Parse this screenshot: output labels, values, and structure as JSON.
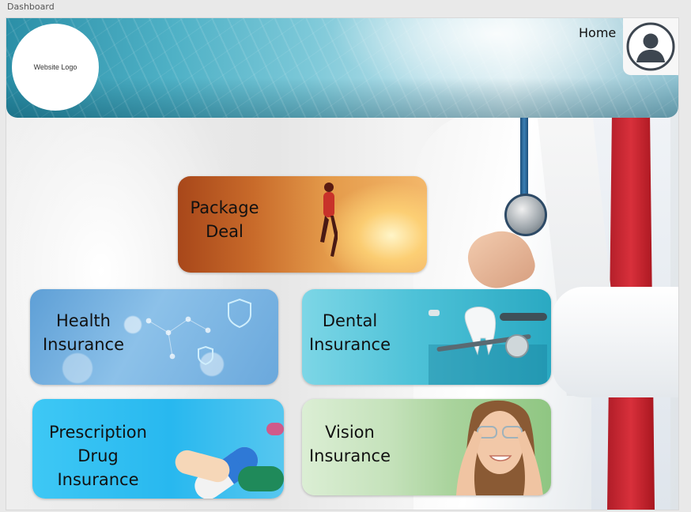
{
  "window": {
    "title": "Dashboard"
  },
  "header": {
    "logo_text": "Website Logo",
    "nav_home": "Home",
    "avatar_icon": "user-silhouette-icon"
  },
  "tiles": {
    "package": {
      "line1": "Package",
      "line2": "Deal"
    },
    "health": {
      "line1": "Health",
      "line2": "Insurance"
    },
    "dental": {
      "line1": "Dental",
      "line2": "Insurance"
    },
    "prescription": {
      "line1": "Prescription",
      "line2": "Drug Insurance"
    },
    "vision": {
      "line1": "Vision",
      "line2": "Insurance"
    }
  }
}
